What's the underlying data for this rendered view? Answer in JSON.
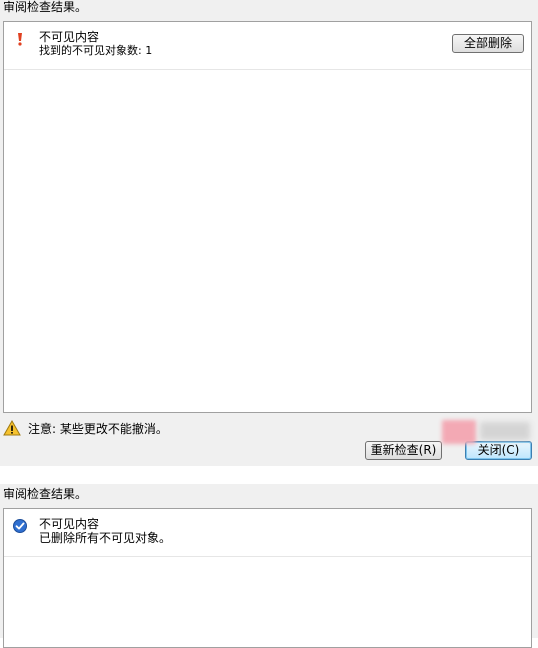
{
  "panel1": {
    "header": "审阅检查结果。",
    "item": {
      "title": "不可见内容",
      "detail": "找到的不可见对象数: 1",
      "status": "warning"
    },
    "remove_all_label": "全部删除",
    "warning_text": "注意: 某些更改不能撤消。",
    "recheck_label": "重新检查(R)",
    "close_label": "关闭(C)"
  },
  "panel2": {
    "header": "审阅检查结果。",
    "item": {
      "title": "不可见内容",
      "detail": "已删除所有不可见对象。",
      "status": "success"
    }
  },
  "colors": {
    "panel_bg": "#f0f0f0",
    "alert_red": "#e04020",
    "success_blue": "#2f6fd0",
    "warning_yellow": "#f6c22e"
  }
}
